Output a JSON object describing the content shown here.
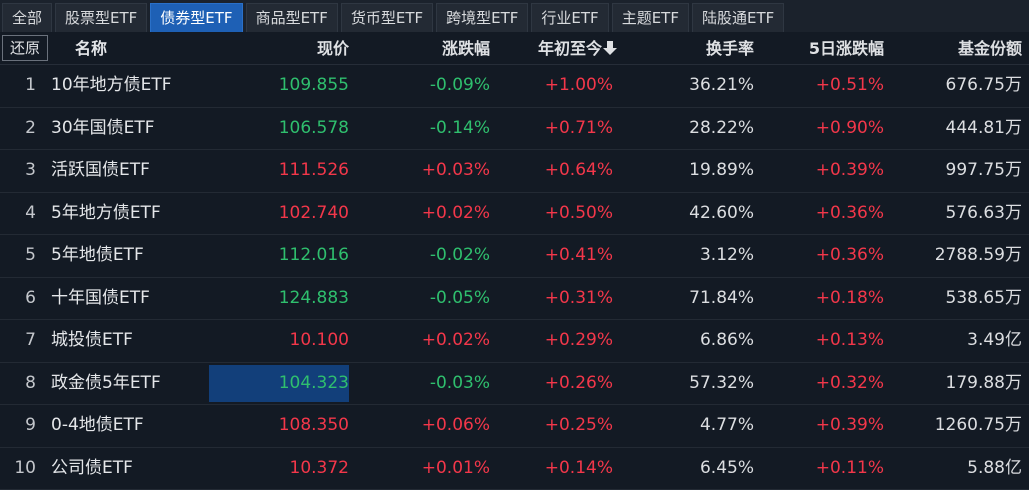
{
  "tabs": [
    {
      "label": "全部",
      "active": false
    },
    {
      "label": "股票型ETF",
      "active": false
    },
    {
      "label": "债券型ETF",
      "active": true
    },
    {
      "label": "商品型ETF",
      "active": false
    },
    {
      "label": "货币型ETF",
      "active": false
    },
    {
      "label": "跨境型ETF",
      "active": false
    },
    {
      "label": "行业ETF",
      "active": false
    },
    {
      "label": "主题ETF",
      "active": false
    },
    {
      "label": "陆股通ETF",
      "active": false
    }
  ],
  "header": {
    "restore": "还原",
    "name": "名称",
    "price": "现价",
    "change": "涨跌幅",
    "ytd": "年初至今",
    "ytd_sort_icon": "sort-desc-icon",
    "turnover": "换手率",
    "change5d": "5日涨跌幅",
    "shares": "基金份额"
  },
  "colors": {
    "up": "#f3374a",
    "down": "#2fbf6e",
    "active_tab": "#1e60b5",
    "selection": "#123f7a"
  },
  "selected_row": 7,
  "rows": [
    {
      "idx": "1",
      "name": "10年地方债ETF",
      "price": "109.855",
      "change": "-0.09%",
      "ytd": "+1.00%",
      "turnover": "36.21%",
      "change5d": "+0.51%",
      "shares": "676.75万"
    },
    {
      "idx": "2",
      "name": "30年国债ETF",
      "price": "106.578",
      "change": "-0.14%",
      "ytd": "+0.71%",
      "turnover": "28.22%",
      "change5d": "+0.90%",
      "shares": "444.81万"
    },
    {
      "idx": "3",
      "name": "活跃国债ETF",
      "price": "111.526",
      "change": "+0.03%",
      "ytd": "+0.64%",
      "turnover": "19.89%",
      "change5d": "+0.39%",
      "shares": "997.75万"
    },
    {
      "idx": "4",
      "name": "5年地方债ETF",
      "price": "102.740",
      "change": "+0.02%",
      "ytd": "+0.50%",
      "turnover": "42.60%",
      "change5d": "+0.36%",
      "shares": "576.63万"
    },
    {
      "idx": "5",
      "name": "5年地债ETF",
      "price": "112.016",
      "change": "-0.02%",
      "ytd": "+0.41%",
      "turnover": "3.12%",
      "change5d": "+0.36%",
      "shares": "2788.59万"
    },
    {
      "idx": "6",
      "name": "十年国债ETF",
      "price": "124.883",
      "change": "-0.05%",
      "ytd": "+0.31%",
      "turnover": "71.84%",
      "change5d": "+0.18%",
      "shares": "538.65万"
    },
    {
      "idx": "7",
      "name": "城投债ETF",
      "price": "10.100",
      "change": "+0.02%",
      "ytd": "+0.29%",
      "turnover": "6.86%",
      "change5d": "+0.13%",
      "shares": "3.49亿"
    },
    {
      "idx": "8",
      "name": "政金债5年ETF",
      "price": "104.323",
      "change": "-0.03%",
      "ytd": "+0.26%",
      "turnover": "57.32%",
      "change5d": "+0.32%",
      "shares": "179.88万"
    },
    {
      "idx": "9",
      "name": "0-4地债ETF",
      "price": "108.350",
      "change": "+0.06%",
      "ytd": "+0.25%",
      "turnover": "4.77%",
      "change5d": "+0.39%",
      "shares": "1260.75万"
    },
    {
      "idx": "10",
      "name": "公司债ETF",
      "price": "10.372",
      "change": "+0.01%",
      "ytd": "+0.14%",
      "turnover": "6.45%",
      "change5d": "+0.11%",
      "shares": "5.88亿"
    }
  ]
}
